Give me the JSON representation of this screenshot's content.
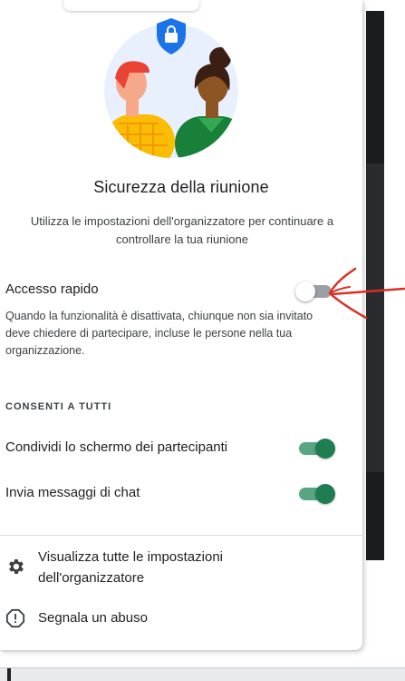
{
  "security_panel": {
    "title": "Sicurezza della riunione",
    "subtitle": "Utilizza le impostazioni dell'organizzatore per continuare a controllare la tua riunione",
    "quick_access": {
      "label": "Accesso rapido",
      "enabled": false,
      "description": "Quando la funzionalità è disattivata, chiunque non sia invitato deve chiedere di partecipare, incluse le persone nella tua organizzazione."
    },
    "allow_all_section": "CONSENTI A TUTTI",
    "allow_all": [
      {
        "label": "Condividi lo schermo dei partecipanti",
        "enabled": true
      },
      {
        "label": "Invia messaggi di chat",
        "enabled": true
      }
    ],
    "actions": [
      {
        "icon": "gear-icon",
        "label": "Visualizza tutte le impostazioni dell'organizzatore"
      },
      {
        "icon": "report-icon",
        "label": "Segnala un abuso"
      }
    ]
  },
  "colors": {
    "toggle_on_thumb": "#1e7d53",
    "toggle_on_track": "#57a583",
    "toggle_off_track": "#9aa0a6",
    "shield": "#1a73e8",
    "annotation": "#d93025"
  }
}
